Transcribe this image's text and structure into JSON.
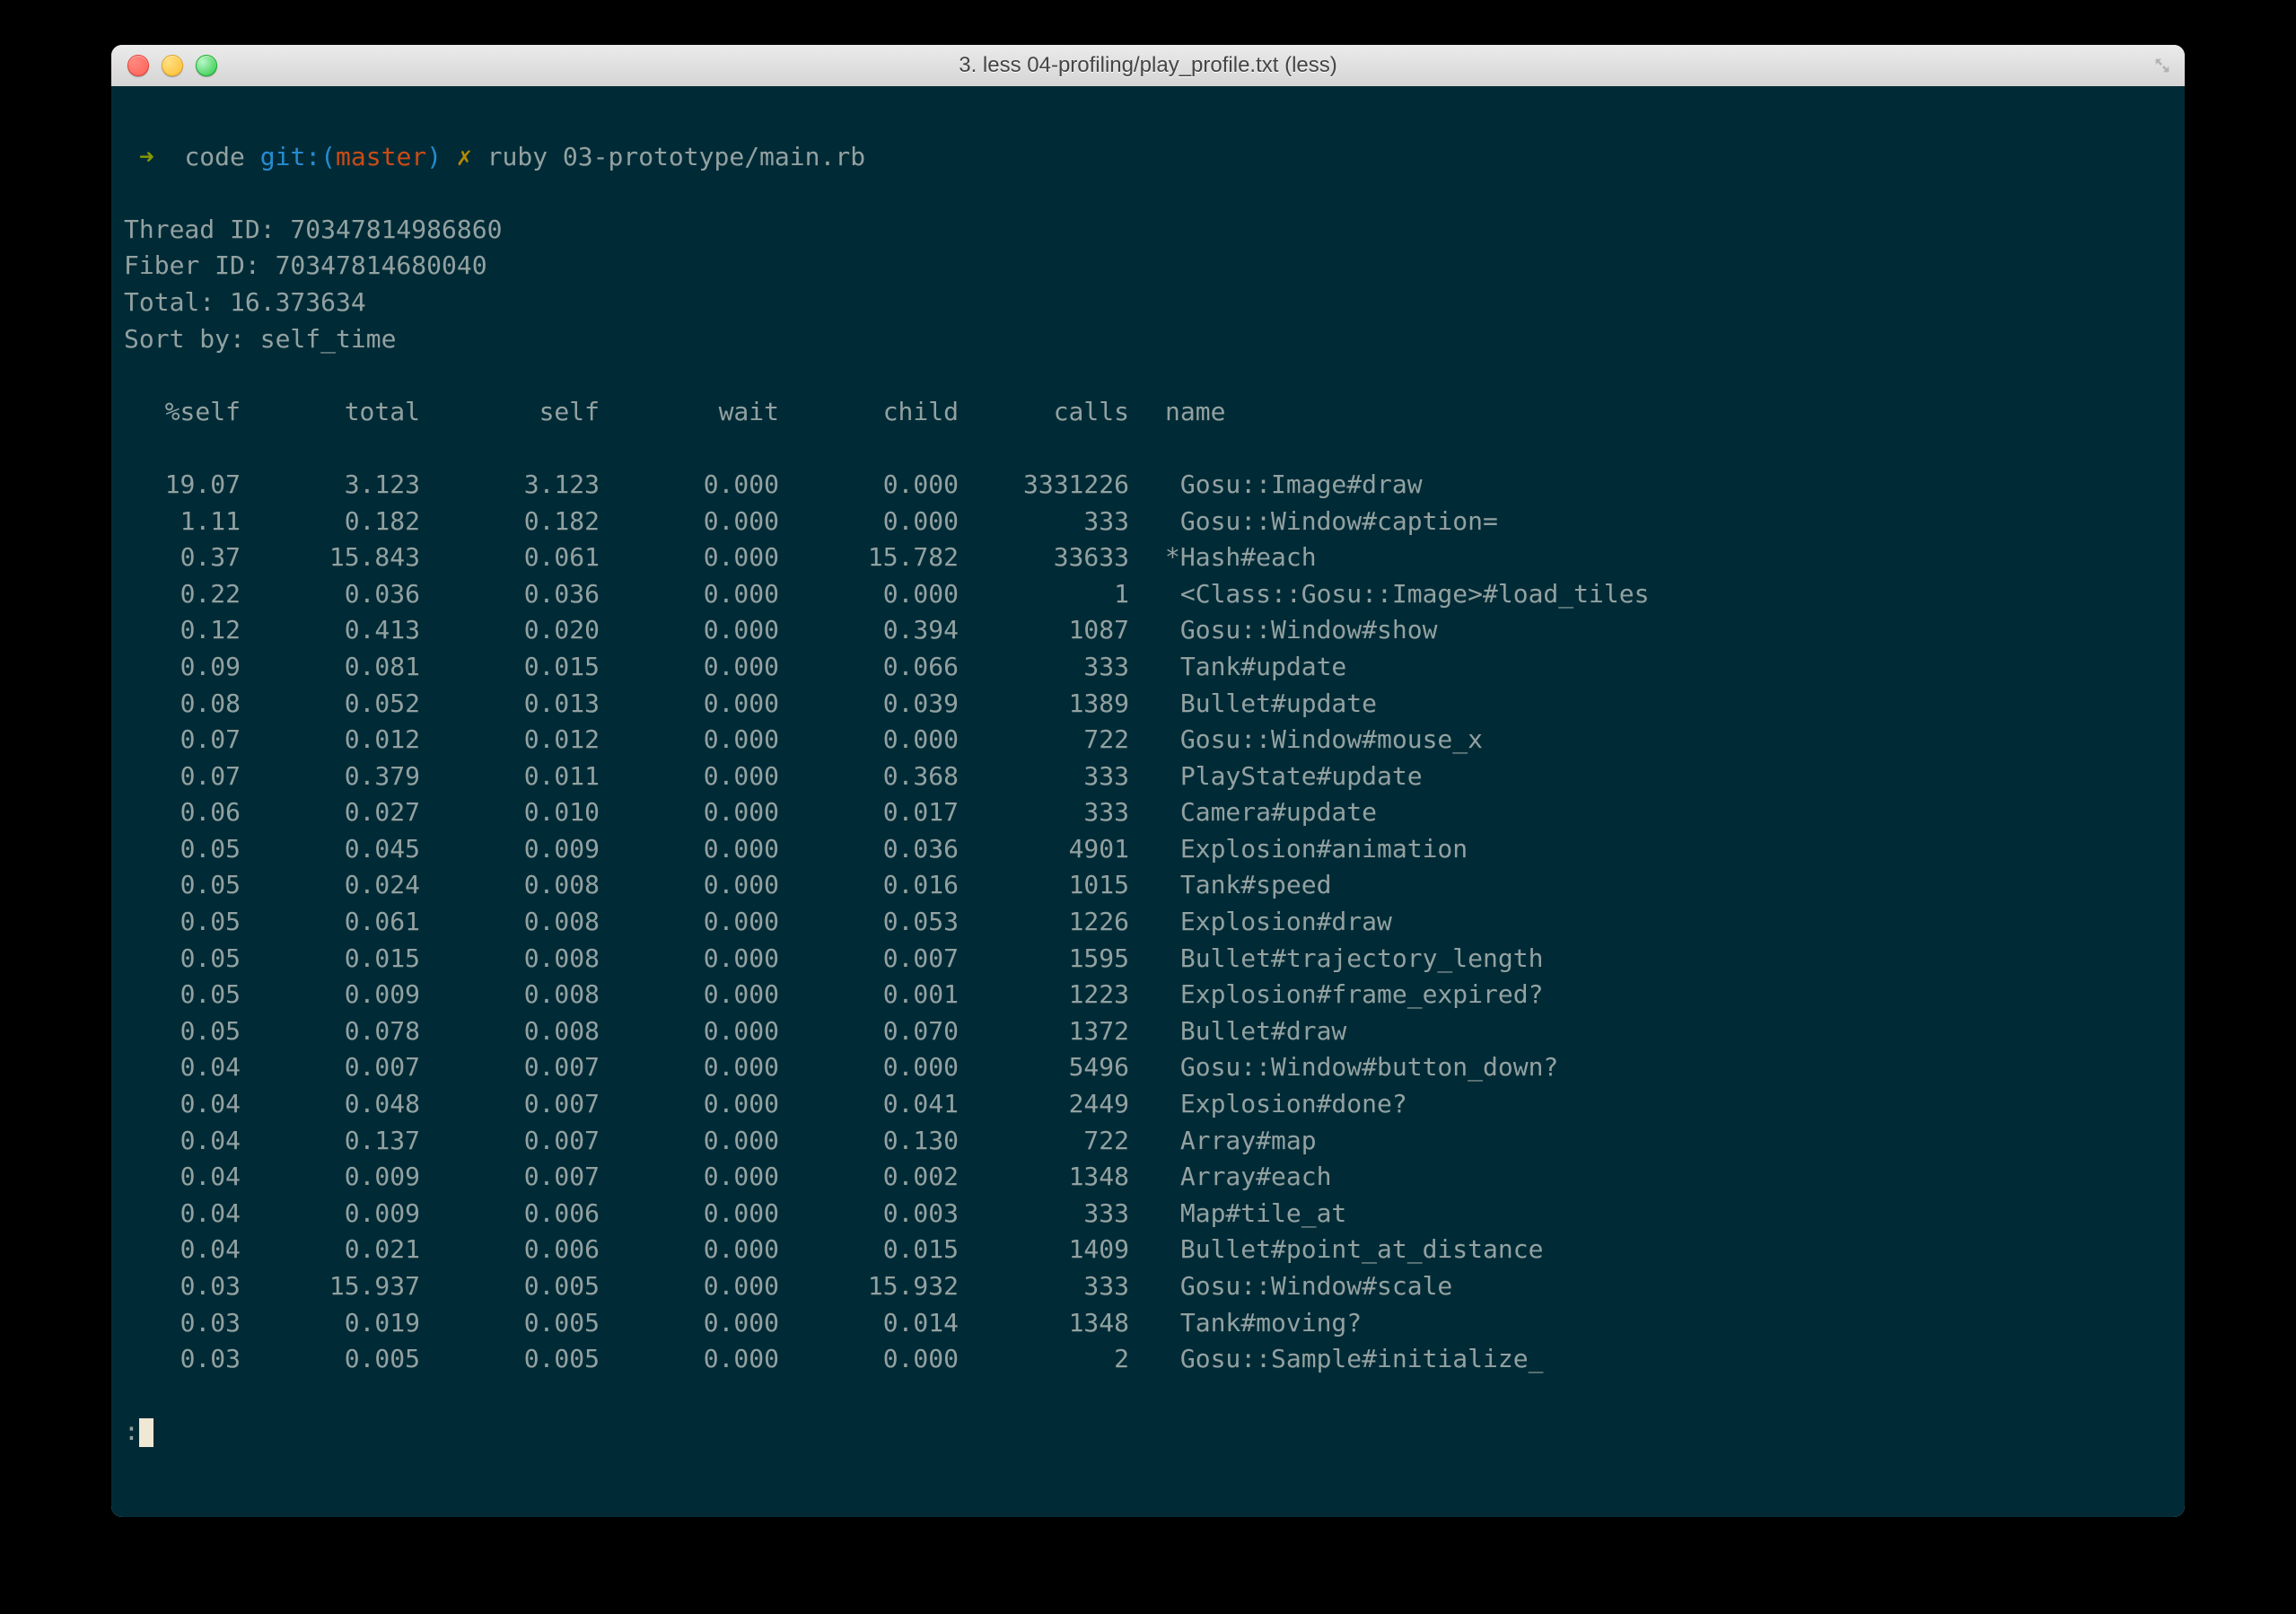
{
  "window": {
    "title": "3. less 04-profiling/play_profile.txt (less)"
  },
  "prompt": {
    "arrow": "➜",
    "path": "code",
    "git_label": "git:(",
    "branch": "master",
    "git_close": ")",
    "dirty": "✗",
    "command": "ruby 03-prototype/main.rb"
  },
  "header": {
    "thread": "Thread ID: 70347814986860",
    "fiber": "Fiber ID: 70347814680040",
    "total": "Total: 16.373634",
    "sort": "Sort by: self_time"
  },
  "columns": {
    "self_pct": "%self",
    "total": "total",
    "self": "self",
    "wait": "wait",
    "child": "child",
    "calls": "calls",
    "name": "name"
  },
  "rows": [
    {
      "self_pct": "19.07",
      "total": "3.123",
      "self": "3.123",
      "wait": "0.000",
      "child": "0.000",
      "calls": "3331226",
      "name": " Gosu::Image#draw"
    },
    {
      "self_pct": "1.11",
      "total": "0.182",
      "self": "0.182",
      "wait": "0.000",
      "child": "0.000",
      "calls": "333",
      "name": " Gosu::Window#caption="
    },
    {
      "self_pct": "0.37",
      "total": "15.843",
      "self": "0.061",
      "wait": "0.000",
      "child": "15.782",
      "calls": "33633",
      "name": "*Hash#each"
    },
    {
      "self_pct": "0.22",
      "total": "0.036",
      "self": "0.036",
      "wait": "0.000",
      "child": "0.000",
      "calls": "1",
      "name": " <Class::Gosu::Image>#load_tiles"
    },
    {
      "self_pct": "0.12",
      "total": "0.413",
      "self": "0.020",
      "wait": "0.000",
      "child": "0.394",
      "calls": "1087",
      "name": " Gosu::Window#show"
    },
    {
      "self_pct": "0.09",
      "total": "0.081",
      "self": "0.015",
      "wait": "0.000",
      "child": "0.066",
      "calls": "333",
      "name": " Tank#update"
    },
    {
      "self_pct": "0.08",
      "total": "0.052",
      "self": "0.013",
      "wait": "0.000",
      "child": "0.039",
      "calls": "1389",
      "name": " Bullet#update"
    },
    {
      "self_pct": "0.07",
      "total": "0.012",
      "self": "0.012",
      "wait": "0.000",
      "child": "0.000",
      "calls": "722",
      "name": " Gosu::Window#mouse_x"
    },
    {
      "self_pct": "0.07",
      "total": "0.379",
      "self": "0.011",
      "wait": "0.000",
      "child": "0.368",
      "calls": "333",
      "name": " PlayState#update"
    },
    {
      "self_pct": "0.06",
      "total": "0.027",
      "self": "0.010",
      "wait": "0.000",
      "child": "0.017",
      "calls": "333",
      "name": " Camera#update"
    },
    {
      "self_pct": "0.05",
      "total": "0.045",
      "self": "0.009",
      "wait": "0.000",
      "child": "0.036",
      "calls": "4901",
      "name": " Explosion#animation"
    },
    {
      "self_pct": "0.05",
      "total": "0.024",
      "self": "0.008",
      "wait": "0.000",
      "child": "0.016",
      "calls": "1015",
      "name": " Tank#speed"
    },
    {
      "self_pct": "0.05",
      "total": "0.061",
      "self": "0.008",
      "wait": "0.000",
      "child": "0.053",
      "calls": "1226",
      "name": " Explosion#draw"
    },
    {
      "self_pct": "0.05",
      "total": "0.015",
      "self": "0.008",
      "wait": "0.000",
      "child": "0.007",
      "calls": "1595",
      "name": " Bullet#trajectory_length"
    },
    {
      "self_pct": "0.05",
      "total": "0.009",
      "self": "0.008",
      "wait": "0.000",
      "child": "0.001",
      "calls": "1223",
      "name": " Explosion#frame_expired?"
    },
    {
      "self_pct": "0.05",
      "total": "0.078",
      "self": "0.008",
      "wait": "0.000",
      "child": "0.070",
      "calls": "1372",
      "name": " Bullet#draw"
    },
    {
      "self_pct": "0.04",
      "total": "0.007",
      "self": "0.007",
      "wait": "0.000",
      "child": "0.000",
      "calls": "5496",
      "name": " Gosu::Window#button_down?"
    },
    {
      "self_pct": "0.04",
      "total": "0.048",
      "self": "0.007",
      "wait": "0.000",
      "child": "0.041",
      "calls": "2449",
      "name": " Explosion#done?"
    },
    {
      "self_pct": "0.04",
      "total": "0.137",
      "self": "0.007",
      "wait": "0.000",
      "child": "0.130",
      "calls": "722",
      "name": " Array#map"
    },
    {
      "self_pct": "0.04",
      "total": "0.009",
      "self": "0.007",
      "wait": "0.000",
      "child": "0.002",
      "calls": "1348",
      "name": " Array#each"
    },
    {
      "self_pct": "0.04",
      "total": "0.009",
      "self": "0.006",
      "wait": "0.000",
      "child": "0.003",
      "calls": "333",
      "name": " Map#tile_at"
    },
    {
      "self_pct": "0.04",
      "total": "0.021",
      "self": "0.006",
      "wait": "0.000",
      "child": "0.015",
      "calls": "1409",
      "name": " Bullet#point_at_distance"
    },
    {
      "self_pct": "0.03",
      "total": "15.937",
      "self": "0.005",
      "wait": "0.000",
      "child": "15.932",
      "calls": "333",
      "name": " Gosu::Window#scale"
    },
    {
      "self_pct": "0.03",
      "total": "0.019",
      "self": "0.005",
      "wait": "0.000",
      "child": "0.014",
      "calls": "1348",
      "name": " Tank#moving?"
    },
    {
      "self_pct": "0.03",
      "total": "0.005",
      "self": "0.005",
      "wait": "0.000",
      "child": "0.000",
      "calls": "2",
      "name": " Gosu::Sample#initialize_"
    }
  ],
  "less_prompt": ":"
}
